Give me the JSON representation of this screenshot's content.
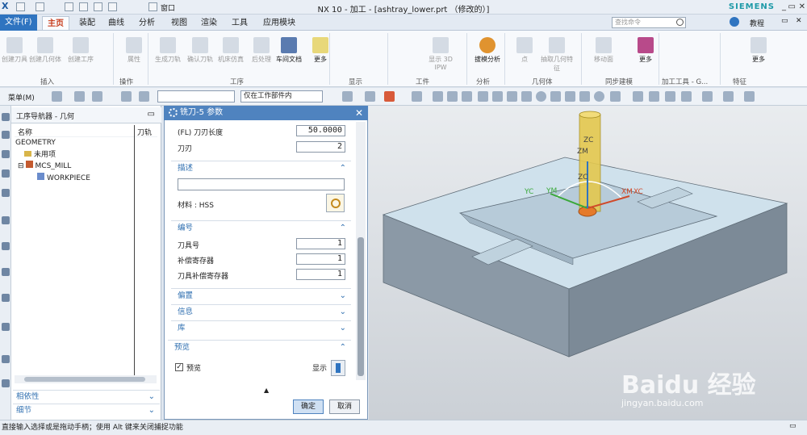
{
  "titlebar": {
    "app_icon": "X",
    "window_menu": "窗口",
    "title": "NX 10 - 加工 - [ashtray_lower.prt （修改的）]",
    "brand": "SIEMENS"
  },
  "ribbon": {
    "tabs": [
      "文件(F)",
      "主页",
      "装配",
      "曲线",
      "分析",
      "视图",
      "渲染",
      "工具",
      "应用模块"
    ],
    "search_placeholder": "查找命令",
    "tutorial": "教程",
    "buttons": [
      "创建刀具",
      "创建几何体",
      "创建工序",
      "属性",
      "生成刀轨",
      "确认刀轨",
      "机床仿真",
      "后处理",
      "车间文档",
      "更多",
      "显示 3D IPW",
      "拔模分析",
      "点",
      "抽取几何特征",
      "移动面",
      "更多",
      "更多"
    ],
    "groups": [
      "插入",
      "操作",
      "工序",
      "显示",
      "工件",
      "分析",
      "几何体",
      "同步建模",
      "加工工具 - G...",
      "特征"
    ]
  },
  "toolbar": {
    "menu": "菜单(M)",
    "filter": "仅在工作部件内"
  },
  "navigator": {
    "title": "工序导航器 - 几何",
    "col_name": "名称",
    "col_path": "刀轨",
    "rows": [
      "GEOMETRY",
      "未用项",
      "MCS_MILL",
      "WORKPIECE"
    ],
    "footer": [
      "相依性",
      "细节"
    ]
  },
  "dialog": {
    "title": "铣刀-5 参数",
    "flute_len_label": "(FL) 刀刃长度",
    "flute_len": "50.0000",
    "flutes_label": "刀刃",
    "flutes": "2",
    "desc_section": "描述",
    "material": "材料 : HSS",
    "num_section": "编号",
    "tool_no_label": "刀具号",
    "tool_no": "1",
    "adj_label": "补偿寄存器",
    "adj": "1",
    "cutcom_label": "刀具补偿寄存器",
    "cutcom": "1",
    "offset_section": "偏置",
    "info_section": "信息",
    "lib_section": "库",
    "preview_section": "预览",
    "preview_label": "预览",
    "show_label": "显示",
    "ok": "确定",
    "cancel": "取消"
  },
  "status": "直接输入选择或是拖动手柄；使用 Alt 键来关闭捕捉功能",
  "view": {
    "axes": [
      "ZC",
      "ZM",
      "ZC",
      "YC",
      "YM",
      "XM",
      "XC"
    ],
    "watermark": "Baidu 经验",
    "watermark_url": "jingyan.baidu.com"
  }
}
